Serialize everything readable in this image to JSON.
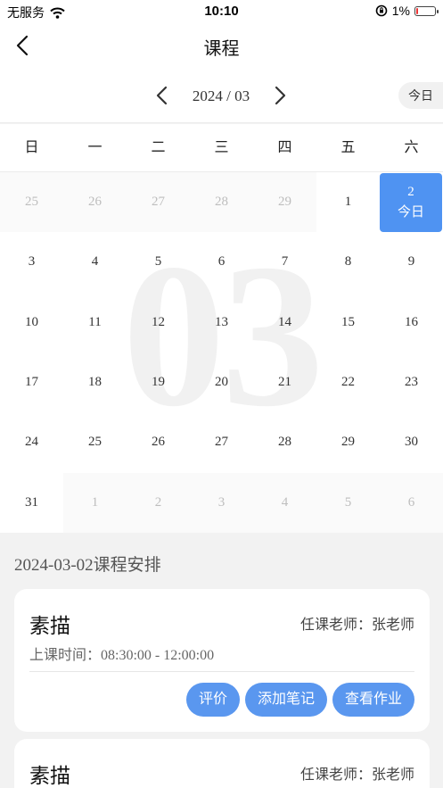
{
  "status": {
    "carrier": "无服务",
    "time": "10:10",
    "battery": "1%",
    "battery_level": 0.01
  },
  "nav": {
    "title": "课程"
  },
  "calendar": {
    "month_label": "2024 / 03",
    "today_button": "今日",
    "watermark": "03",
    "weekdays": [
      "日",
      "一",
      "二",
      "三",
      "四",
      "五",
      "六"
    ],
    "rows": [
      [
        {
          "d": "25",
          "o": true
        },
        {
          "d": "26",
          "o": true
        },
        {
          "d": "27",
          "o": true
        },
        {
          "d": "28",
          "o": true
        },
        {
          "d": "29",
          "o": true
        },
        {
          "d": "1"
        },
        {
          "d": "2",
          "sel": true,
          "sub": "今日"
        }
      ],
      [
        {
          "d": "3"
        },
        {
          "d": "4"
        },
        {
          "d": "5"
        },
        {
          "d": "6"
        },
        {
          "d": "7"
        },
        {
          "d": "8"
        },
        {
          "d": "9"
        }
      ],
      [
        {
          "d": "10"
        },
        {
          "d": "11"
        },
        {
          "d": "12"
        },
        {
          "d": "13"
        },
        {
          "d": "14"
        },
        {
          "d": "15"
        },
        {
          "d": "16"
        }
      ],
      [
        {
          "d": "17"
        },
        {
          "d": "18"
        },
        {
          "d": "19"
        },
        {
          "d": "20"
        },
        {
          "d": "21"
        },
        {
          "d": "22"
        },
        {
          "d": "23"
        }
      ],
      [
        {
          "d": "24"
        },
        {
          "d": "25"
        },
        {
          "d": "26"
        },
        {
          "d": "27"
        },
        {
          "d": "28"
        },
        {
          "d": "29"
        },
        {
          "d": "30"
        }
      ],
      [
        {
          "d": "31"
        },
        {
          "d": "1",
          "o": true
        },
        {
          "d": "2",
          "o": true
        },
        {
          "d": "3",
          "o": true
        },
        {
          "d": "4",
          "o": true
        },
        {
          "d": "5",
          "o": true
        },
        {
          "d": "6",
          "o": true
        }
      ]
    ]
  },
  "schedule": {
    "date": "2024-03-02",
    "title_suffix": "课程安排",
    "courses": [
      {
        "name": "素描",
        "teacher": "任课老师：张老师",
        "time_label": "上课时间：",
        "time_value": "08:30:00 - 12:00:00",
        "buttons": [
          "评价",
          "添加笔记",
          "查看作业"
        ]
      },
      {
        "name": "素描",
        "teacher": "任课老师：张老师"
      }
    ]
  },
  "colors": {
    "accent": "#4f93f2",
    "button": "#5a97ef",
    "background": "#f2f2f2"
  }
}
